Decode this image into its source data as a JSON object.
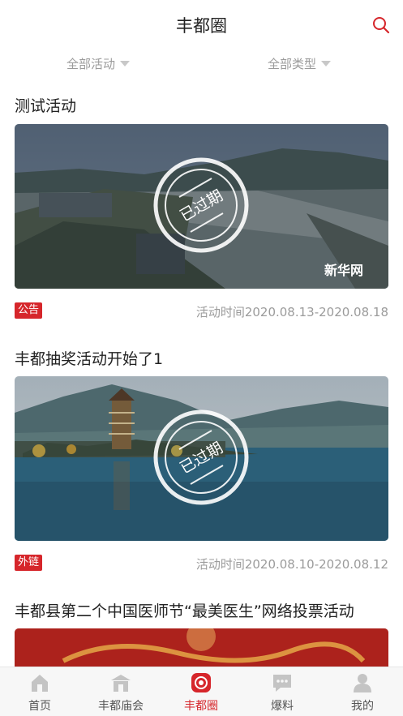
{
  "header": {
    "title": "丰都圈",
    "search_icon": "search-icon"
  },
  "filters": {
    "activity": "全部活动",
    "type": "全部类型"
  },
  "stamp_text": "已过期",
  "cards": [
    {
      "title": "测试活动",
      "tag": "公告",
      "time": "活动时间2020.08.13-2020.08.18",
      "watermark": "新华网"
    },
    {
      "title": "丰都抽奖活动开始了1",
      "tag": "外链",
      "time": "活动时间2020.08.10-2020.08.12"
    },
    {
      "title": "丰都县第二个中国医师节“最美医生”网络投票活动"
    }
  ],
  "tabs": [
    {
      "label": "首页",
      "icon": "home-icon"
    },
    {
      "label": "丰都庙会",
      "icon": "temple-icon"
    },
    {
      "label": "丰都圈",
      "icon": "circle-icon",
      "active": true
    },
    {
      "label": "爆料",
      "icon": "chat-icon"
    },
    {
      "label": "我的",
      "icon": "user-icon"
    }
  ],
  "colors": {
    "accent": "#d6262b",
    "muted": "#9b9b9b"
  }
}
